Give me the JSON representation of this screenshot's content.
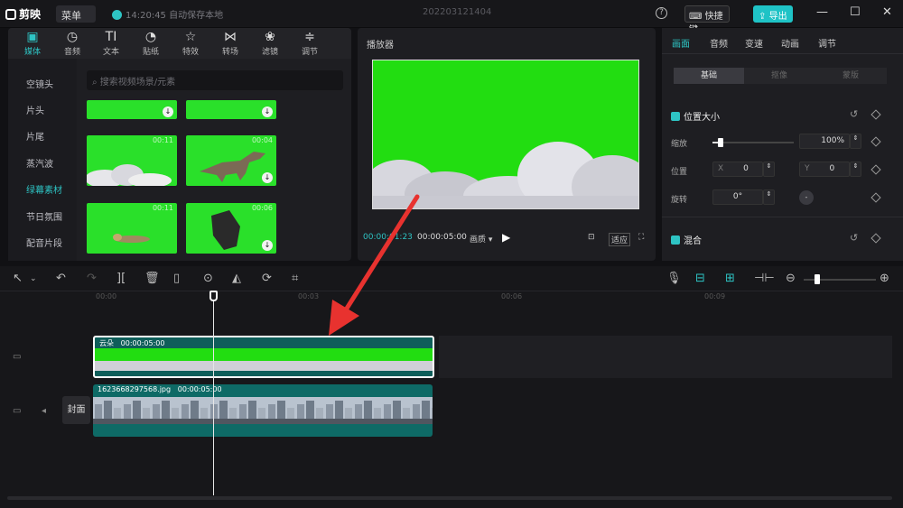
{
  "app": {
    "name": "剪映",
    "menu": "菜单",
    "save_time": "14:20:45",
    "save_text": "自动保存本地",
    "project": "202203121404",
    "shortcut": "快捷键",
    "export": "导出"
  },
  "media": {
    "tools": [
      "媒体",
      "音频",
      "文本",
      "贴纸",
      "特效",
      "转场",
      "滤镜",
      "调节"
    ],
    "categories": [
      "空镜头",
      "片头",
      "片尾",
      "蒸汽波",
      "绿幕素材",
      "节日氛围",
      "配音片段"
    ],
    "active_category": "绿幕素材",
    "search_placeholder": "搜索视频场景/元素",
    "thumbs": [
      {
        "duration": ""
      },
      {
        "duration": ""
      },
      {
        "duration": "00:11"
      },
      {
        "duration": "00:04"
      },
      {
        "duration": "00:11"
      },
      {
        "duration": "00:06"
      }
    ]
  },
  "player": {
    "title": "播放器",
    "current": "00:00:01:23",
    "total": "00:00:05:00",
    "ratio": "画质",
    "fit": "适应"
  },
  "props": {
    "tabs": [
      "画面",
      "音频",
      "变速",
      "动画",
      "调节"
    ],
    "subtabs": [
      "基础",
      "抠像",
      "蒙版"
    ],
    "section1": "位置大小",
    "scale_label": "缩放",
    "scale_value": "100%",
    "scale_level": 0.1,
    "position_label": "位置",
    "x_label": "X",
    "x_value": "0",
    "y_label": "Y",
    "y_value": "0",
    "rotate_label": "旋转",
    "rotate_value": "0°",
    "section2": "混合"
  },
  "timeline": {
    "ticks": [
      "00:00",
      "00:03",
      "00:06",
      "00:09"
    ],
    "clip1": {
      "name": "云朵",
      "duration": "00:00:05:00"
    },
    "clip2": {
      "name": "1623668297568.jpg",
      "duration": "00:00:05:00"
    },
    "cover": "封面"
  }
}
